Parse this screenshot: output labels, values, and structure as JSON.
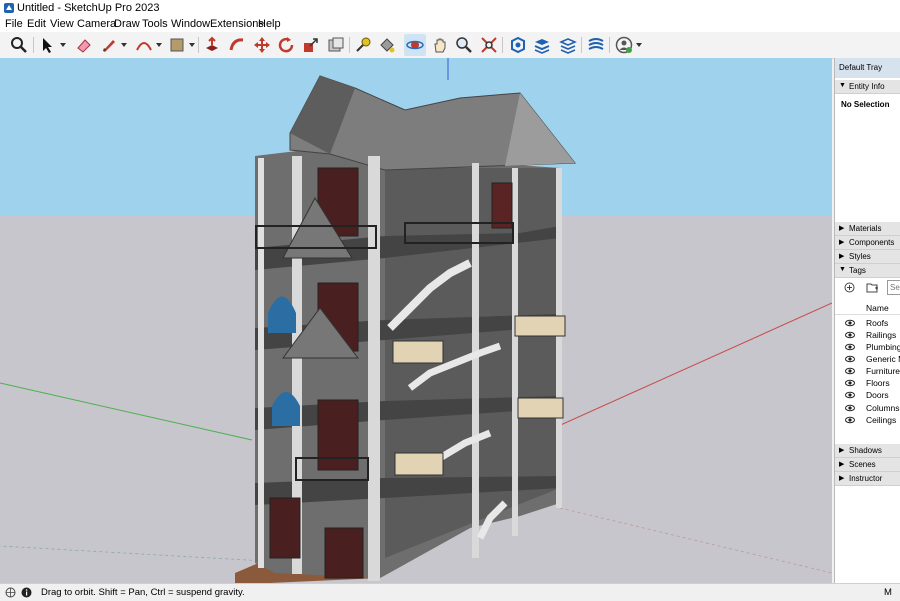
{
  "window": {
    "title": "Untitled - SketchUp Pro 2023"
  },
  "menu": [
    "File",
    "Edit",
    "View",
    "Camera",
    "Draw",
    "Tools",
    "Window",
    "Extensions",
    "Help"
  ],
  "tray": {
    "title": "Default Tray",
    "entity_info": {
      "label": "Entity Info",
      "expanded": true,
      "content": "No Selection"
    },
    "panels_top": [
      {
        "label": "Materials",
        "expanded": false
      },
      {
        "label": "Components",
        "expanded": false
      },
      {
        "label": "Styles",
        "expanded": false
      },
      {
        "label": "Tags",
        "expanded": true
      }
    ],
    "tags": {
      "search_placeholder": "Sea",
      "column_header": "Name",
      "items": [
        "Roofs",
        "Railings",
        "Plumbing",
        "Generic M",
        "Furniture",
        "Floors",
        "Doors",
        "Columns",
        "Ceilings"
      ]
    },
    "panels_bottom": [
      {
        "label": "Shadows",
        "expanded": false
      },
      {
        "label": "Scenes",
        "expanded": false
      },
      {
        "label": "Instructor",
        "expanded": false
      }
    ]
  },
  "status": {
    "text": "Drag to orbit. Shift = Pan, Ctrl = suspend gravity.",
    "right_text": "M"
  },
  "colors": {
    "sky": "#9fd2ec",
    "ground": "#c7c6cc",
    "tray_header": "#d6e2ee",
    "axis_red": "#c84a4a",
    "axis_green": "#4caf50",
    "axis_blue": "#3b5bd8"
  },
  "icons": [
    "zoom-icon",
    "select-icon",
    "eraser-icon",
    "pencil-icon",
    "arc-icon",
    "rectangle-icon",
    "push-pull-icon",
    "follow-me-icon",
    "move-icon",
    "rotate-icon",
    "scale-icon",
    "offset-icon",
    "tape-measure-icon",
    "paint-bucket-icon",
    "orbit-icon",
    "pan-icon",
    "zoom-window-icon",
    "zoom-extents-icon",
    "warehouse-icon",
    "extension-warehouse-icon",
    "layout-icon",
    "sandbox-icon",
    "profile-icon"
  ]
}
